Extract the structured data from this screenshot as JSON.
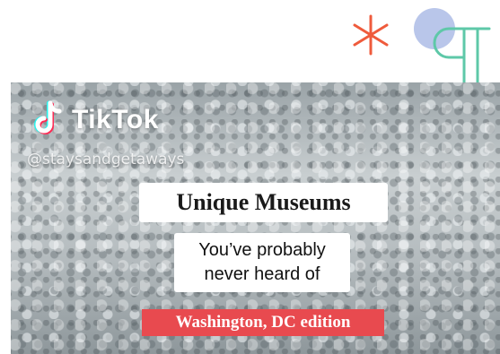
{
  "decorations": {
    "asterisk_color": "#ef5b3c",
    "circle_color": "#b9c6ea",
    "pilcrow_color": "#5ec8a8"
  },
  "video": {
    "watermark": {
      "logo_icon": "tiktok-note-icon",
      "brand": "TikTok",
      "handle": "@staysandgetaways"
    },
    "title": "Unique Museums",
    "subtitle_line1": "You’ve probably",
    "subtitle_line2": "never heard of",
    "edition": "Washington, DC edition",
    "edition_color": "#e84a4f"
  }
}
